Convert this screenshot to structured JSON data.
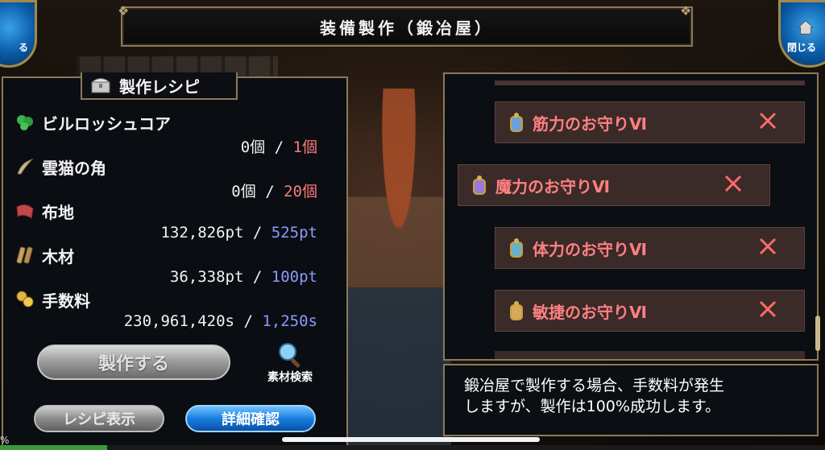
{
  "window": {
    "title": "装備製作（鍛冶屋）"
  },
  "top_left_button": {
    "label": "る"
  },
  "top_right_button": {
    "label": "閉じる"
  },
  "recipe_panel": {
    "title": "製作レシピ",
    "materials": [
      {
        "name": "ビルロッシュコア",
        "icon": "green-crystal-icon",
        "have": "0個",
        "need": "1個",
        "need_color": "red"
      },
      {
        "name": "雲猫の角",
        "icon": "horn-icon",
        "have": "0個",
        "need": "20個",
        "need_color": "red"
      },
      {
        "name": "布地",
        "icon": "cloth-icon",
        "have": "132,826pt",
        "need": "525pt",
        "need_color": "blue"
      },
      {
        "name": "木材",
        "icon": "wood-icon",
        "have": "36,338pt",
        "need": "100pt",
        "need_color": "blue"
      },
      {
        "name": "手数料",
        "icon": "coins-icon",
        "have": "230,961,420s",
        "need": "1,250s",
        "need_color": "blue"
      }
    ],
    "separator": "/",
    "craft_button": "製作する",
    "search_label": "素材検索",
    "recipe_view_button": "レシピ表示",
    "detail_button": "詳細確認"
  },
  "item_list": [
    {
      "name": "筋力のお守りⅥ"
    },
    {
      "name": "魔力のお守りⅥ"
    },
    {
      "name": "体力のお守りⅥ"
    },
    {
      "name": "敏捷のお守りⅥ"
    }
  ],
  "info": {
    "line1": "鍛冶屋で製作する場合、手数料が発生",
    "line2": "しますが、製作は100%成功します。"
  },
  "footer": {
    "xp_percent_label": "%",
    "xp_fill": 0.13
  },
  "colors": {
    "need_red": "#ff7b7b",
    "need_blue": "#8e9aff",
    "item_red": "#ff8080",
    "detail_blue": "#1a7fe0"
  }
}
